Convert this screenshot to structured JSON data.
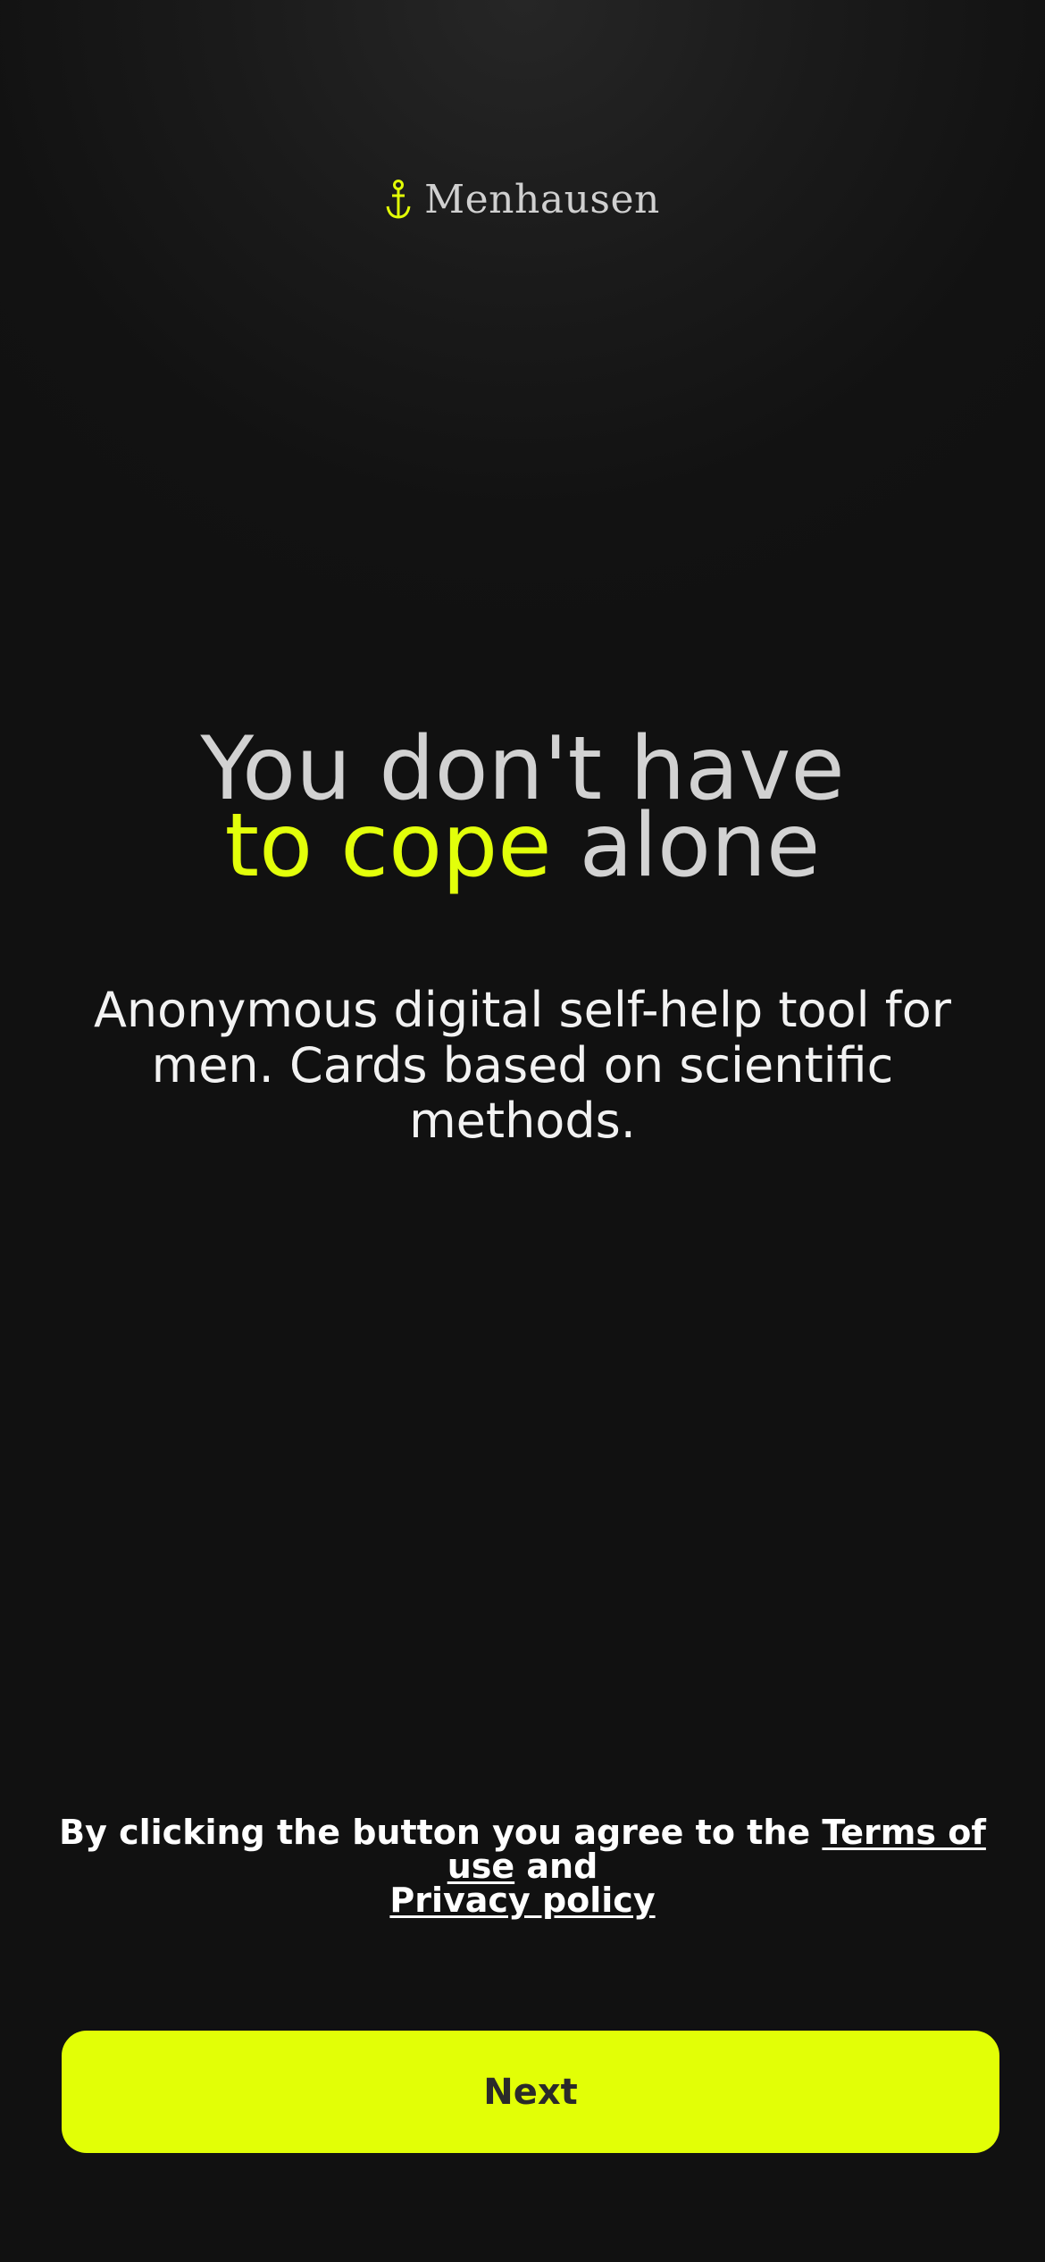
{
  "app": {
    "name": "Menhausen",
    "logo_icon": "anchor-icon",
    "accent_color": "#e2ff06"
  },
  "headline": {
    "line1": "You don't have",
    "line2_accent": "to cope",
    "line2_rest": " alone"
  },
  "subtitle": "Anonymous digital self-help tool for men. Cards based on scientific methods.",
  "legal": {
    "prefix": "By clicking the button you agree to the ",
    "terms_link": "Terms of use",
    "conjunction": " and ",
    "privacy_link": "Privacy policy"
  },
  "actions": {
    "next_label": "Next"
  }
}
